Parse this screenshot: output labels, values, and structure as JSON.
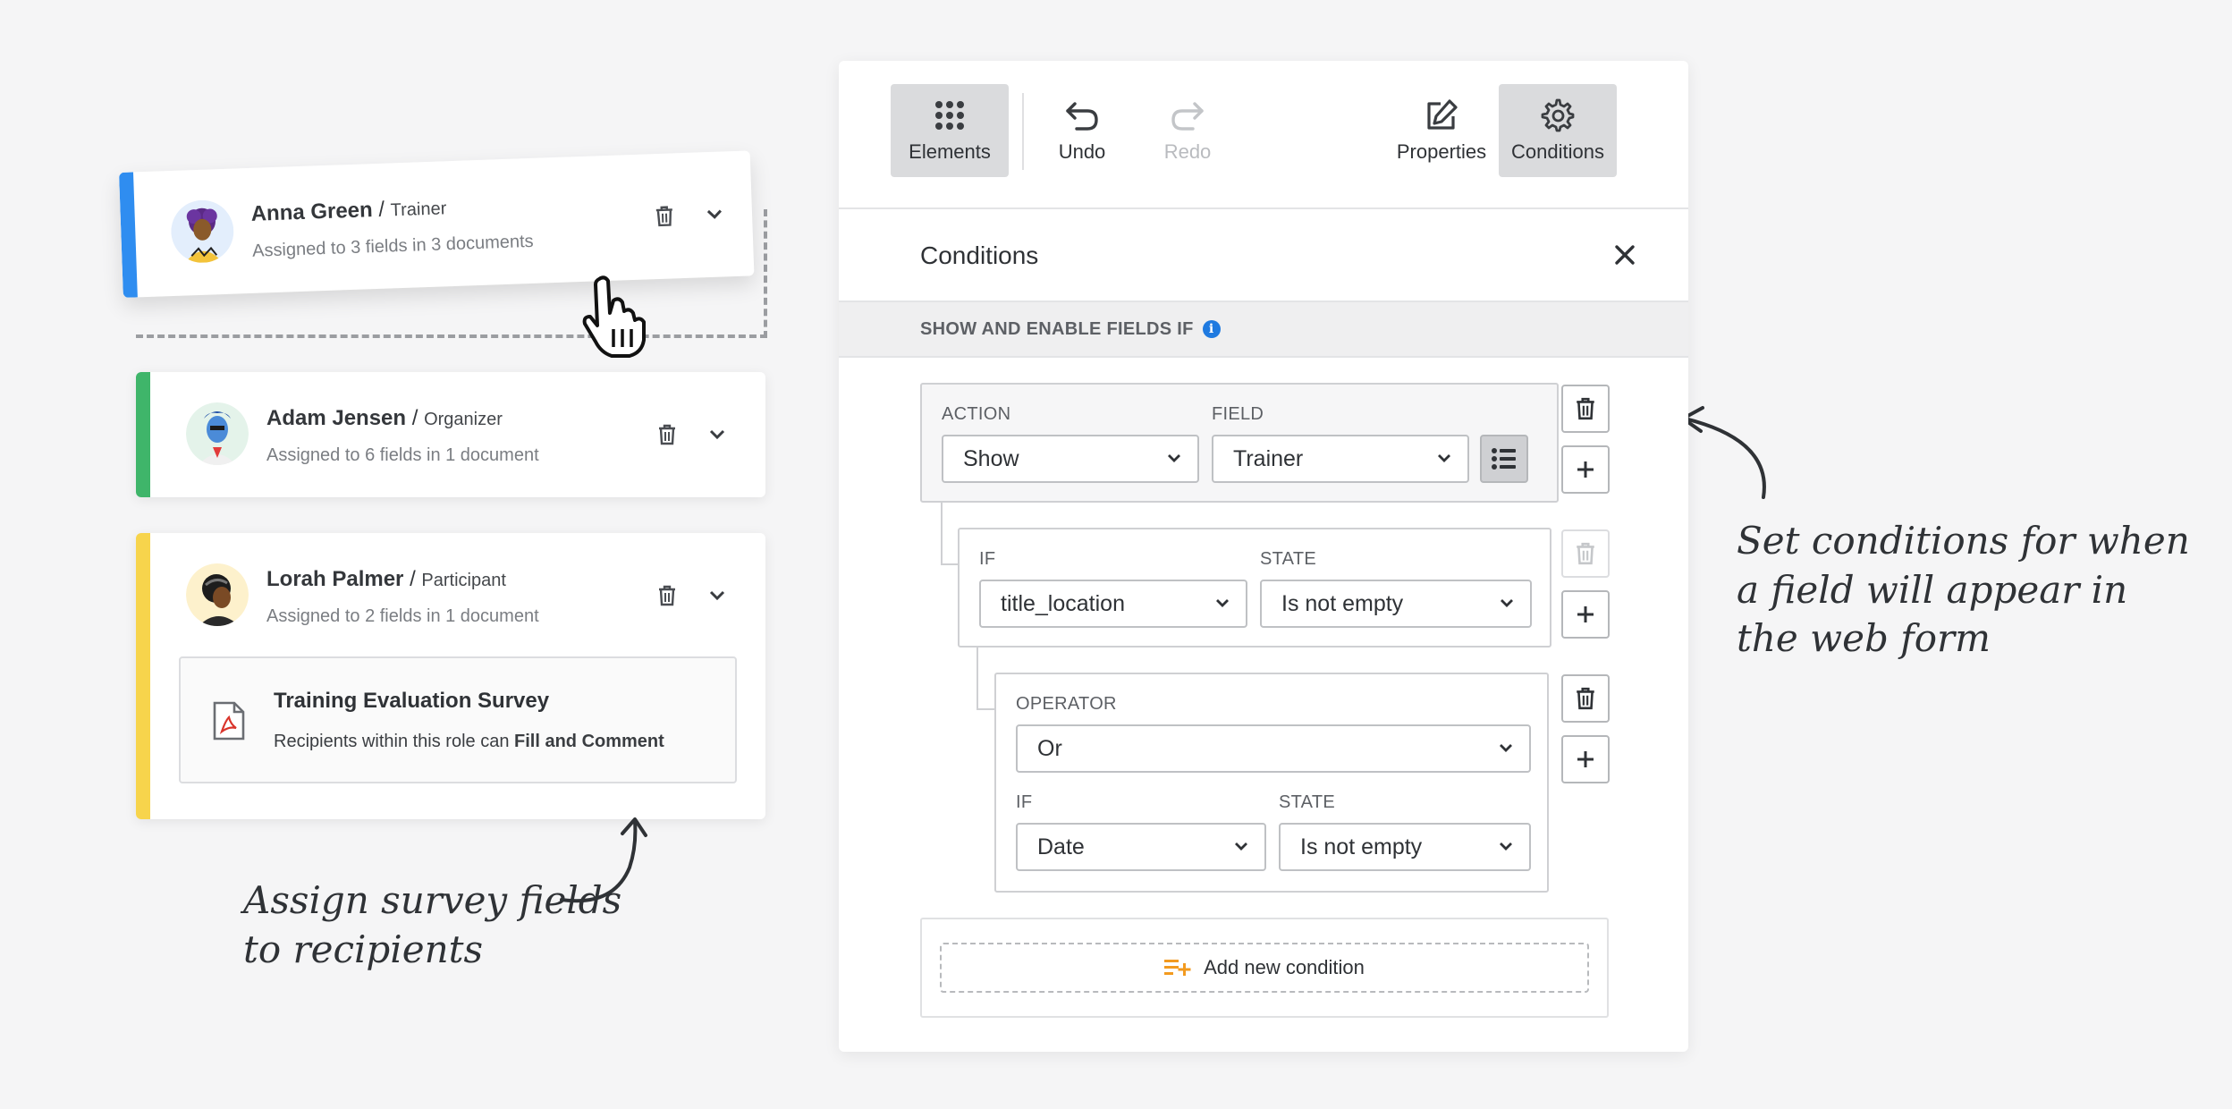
{
  "recipients": [
    {
      "name": "Anna Green",
      "role": "Trainer",
      "assigned": "Assigned to 3 fields in 3 documents",
      "color": "#2f8df0"
    },
    {
      "name": "Adam Jensen",
      "role": "Organizer",
      "assigned": "Assigned to 6 fields in 1 document",
      "color": "#3fb56a"
    },
    {
      "name": "Lorah Palmer",
      "role": "Participant",
      "assigned": "Assigned to 2 fields in 1 document",
      "color": "#f7d44c",
      "document": {
        "title": "Training Evaluation Survey",
        "permission_prefix": "Recipients within this role can ",
        "permission": "Fill and Comment"
      }
    }
  ],
  "notes": {
    "left": [
      "Assign survey fields",
      "to recipients"
    ],
    "right": [
      "Set conditions for when",
      "a field will appear in",
      "the web form"
    ]
  },
  "toolbar": {
    "elements": "Elements",
    "undo": "Undo",
    "redo": "Redo",
    "properties": "Properties",
    "conditions": "Conditions"
  },
  "conditions_panel": {
    "title": "Conditions",
    "subheader": "SHOW AND ENABLE FIELDS IF",
    "rule": {
      "action_label": "ACTION",
      "action_value": "Show",
      "field_label": "FIELD",
      "field_value": "Trainer"
    },
    "if1": {
      "if_label": "IF",
      "if_value": "title_location",
      "state_label": "STATE",
      "state_value": "Is not empty"
    },
    "group": {
      "operator_label": "OPERATOR",
      "operator_value": "Or",
      "if_label": "IF",
      "if_value": "Date",
      "state_label": "STATE",
      "state_value": "Is not empty"
    },
    "add_condition": "Add new condition"
  }
}
